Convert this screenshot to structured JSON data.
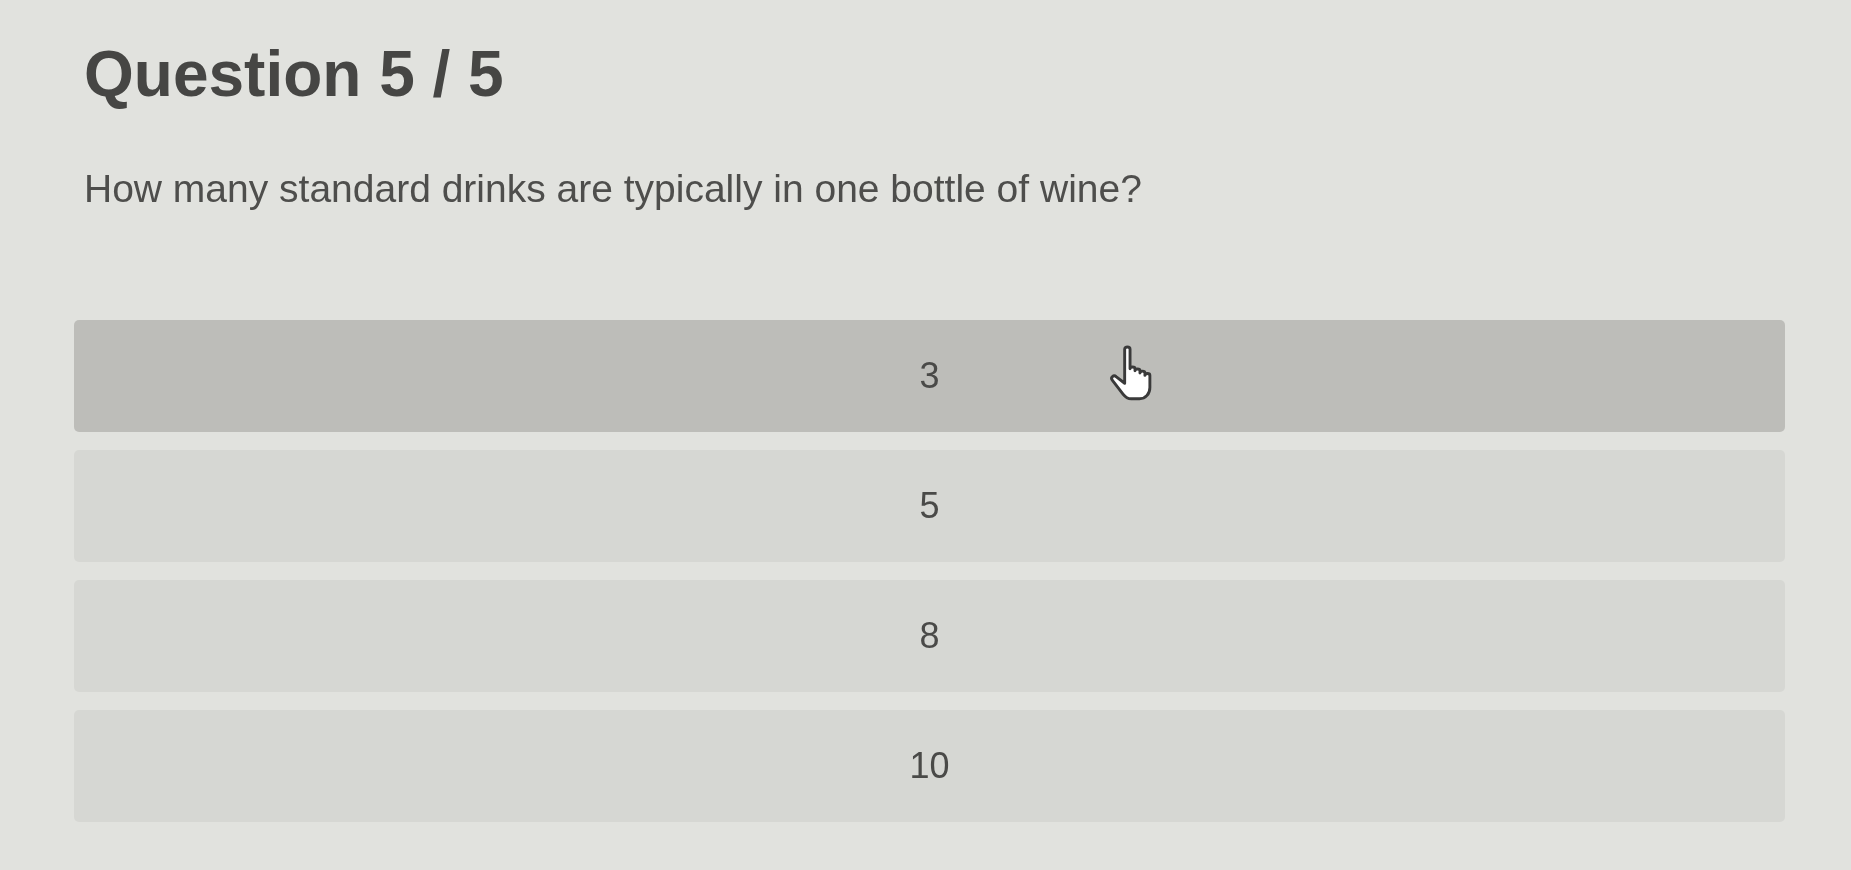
{
  "title": "Question 5 / 5",
  "question": "How many standard drinks are typically in one bottle of wine?",
  "options": [
    {
      "label": "3",
      "hovered": true
    },
    {
      "label": "5",
      "hovered": false
    },
    {
      "label": "8",
      "hovered": false
    },
    {
      "label": "10",
      "hovered": false
    }
  ]
}
